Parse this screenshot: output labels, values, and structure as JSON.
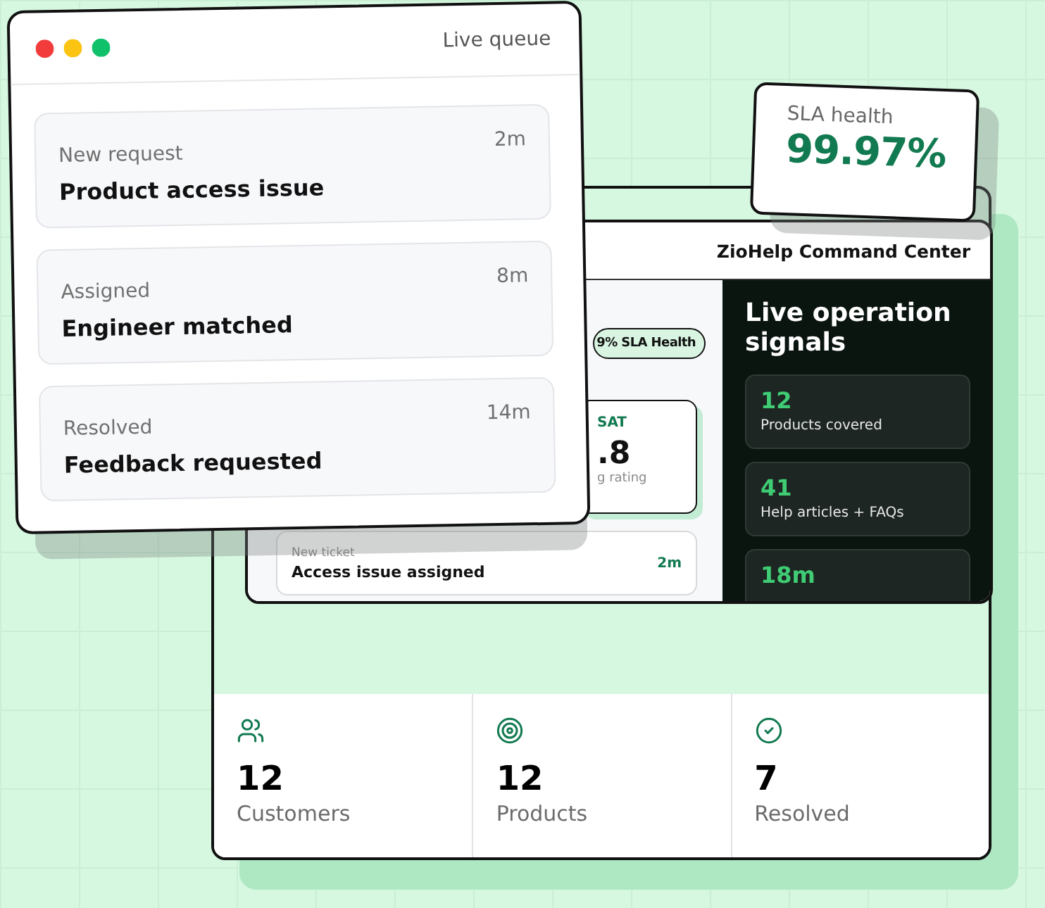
{
  "queue_window": {
    "title": "Live queue",
    "items": [
      {
        "status": "New request",
        "title": "Product access issue",
        "age": "2m"
      },
      {
        "status": "Assigned",
        "title": "Engineer matched",
        "age": "8m"
      },
      {
        "status": "Resolved",
        "title": "Feedback requested",
        "age": "14m"
      }
    ]
  },
  "sla_card": {
    "label": "SLA health",
    "value": "99.97%"
  },
  "dashboard": {
    "title": "ZioHelp Command Center",
    "sla_pill": "9% SLA Health",
    "csat": {
      "label": "SAT",
      "value": ".8",
      "caption": "g rating"
    },
    "ticket": {
      "label": "New ticket",
      "title": "Access issue assigned",
      "age": "2m"
    },
    "signals": {
      "title": "Live operation signals",
      "items": [
        {
          "value": "12",
          "label": "Products covered"
        },
        {
          "value": "41",
          "label": "Help articles + FAQs"
        },
        {
          "value": "18m"
        }
      ]
    }
  },
  "stats": [
    {
      "kind": "customers",
      "value": "12",
      "label": "Customers"
    },
    {
      "kind": "products",
      "value": "12",
      "label": "Products"
    },
    {
      "kind": "resolved",
      "value": "7",
      "label": "Resolved"
    }
  ]
}
